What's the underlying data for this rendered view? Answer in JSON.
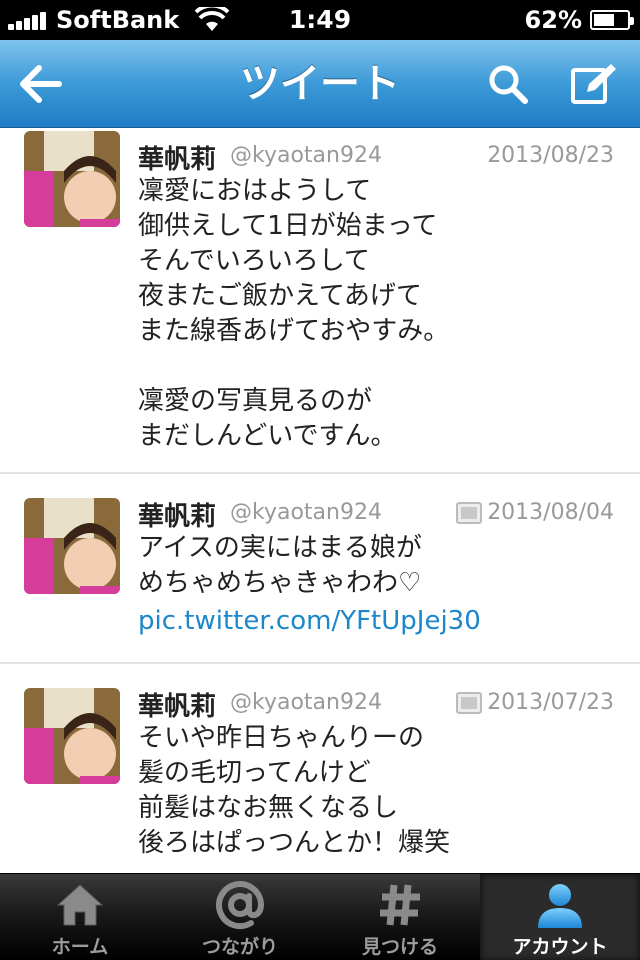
{
  "status_bar": {
    "carrier": "SoftBank",
    "time": "1:49",
    "battery_percent_label": "62%",
    "battery_level": 0.62
  },
  "nav": {
    "title": "ツイート",
    "back_icon": "arrow-left-icon",
    "search_icon": "search-icon",
    "compose_icon": "compose-icon"
  },
  "tweets": [
    {
      "name": "華帆莉",
      "handle": "@kyaotan924",
      "date": "2013/08/23",
      "has_media": false,
      "body": "凜愛におはようして\n御供えして1日が始まって\nそんでいろいろして\n夜またご飯かえてあげて\nまた線香あげておやすみ。\n\n凜愛の写真見るのが\nまだしんどいですん。",
      "link": ""
    },
    {
      "name": "華帆莉",
      "handle": "@kyaotan924",
      "date": "2013/08/04",
      "has_media": true,
      "body": "アイスの実にはまる娘が\nめちゃめちゃきゃわわ♡",
      "link": "pic.twitter.com/YFtUpJej30"
    },
    {
      "name": "華帆莉",
      "handle": "@kyaotan924",
      "date": "2013/07/23",
      "has_media": true,
      "body": "そいや昨日ちゃんりーの\n髪の毛切ってんけど\n前髪はなお無くなるし\n後ろはぱっつんとか！爆笑",
      "link": ""
    }
  ],
  "tab_bar": {
    "tabs": [
      {
        "label": "ホーム",
        "icon": "home-icon",
        "active": false
      },
      {
        "label": "つながり",
        "icon": "at-icon",
        "active": false
      },
      {
        "label": "見つける",
        "icon": "hashtag-icon",
        "active": false
      },
      {
        "label": "アカウント",
        "icon": "person-icon",
        "active": true
      }
    ]
  },
  "colors": {
    "nav_blue": "#3d9ad8",
    "link_blue": "#1c87c9",
    "meta_gray": "#999999"
  }
}
